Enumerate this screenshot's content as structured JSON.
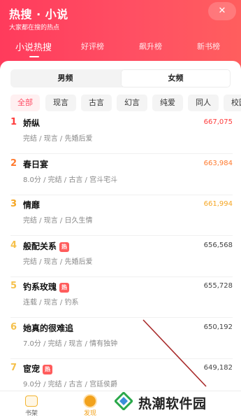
{
  "header": {
    "brand": "热搜 · 小说",
    "slogan": "大家都在搜的热点",
    "close_icon": "✕",
    "tabs": [
      {
        "label": "小说热搜",
        "active": true
      },
      {
        "label": "好评榜",
        "active": false
      },
      {
        "label": "飙升榜",
        "active": false
      },
      {
        "label": "新书榜",
        "active": false
      }
    ],
    "accent_color": "#ff4b63"
  },
  "gender_tabs": [
    {
      "label": "男频",
      "selected": false
    },
    {
      "label": "女频",
      "selected": true
    }
  ],
  "category_chips": [
    {
      "label": "全部",
      "active": true
    },
    {
      "label": "现言",
      "active": false
    },
    {
      "label": "古言",
      "active": false
    },
    {
      "label": "幻言",
      "active": false
    },
    {
      "label": "纯爱",
      "active": false
    },
    {
      "label": "同人",
      "active": false
    },
    {
      "label": "校园",
      "active": false
    }
  ],
  "ranking": [
    {
      "rank": "1",
      "title": "娇纵",
      "hot": false,
      "meta": "完结 / 现言 / 先婚后爱",
      "count": "667,075",
      "rank_color": "#ff3b3b",
      "count_color": "#ff3b3b"
    },
    {
      "rank": "2",
      "title": "春日宴",
      "hot": false,
      "meta": "8.0分 / 完结 / 古言 / 宫斗宅斗",
      "count": "663,984",
      "rank_color": "#ff7a2e",
      "count_color": "#ff7a2e"
    },
    {
      "rank": "3",
      "title": "情靡",
      "hot": false,
      "meta": "完结 / 现言 / 日久生情",
      "count": "661,994",
      "rank_color": "#f5a623",
      "count_color": "#f5a623"
    },
    {
      "rank": "4",
      "title": "般配关系",
      "hot": true,
      "meta": "完结 / 现言 / 先婚后爱",
      "count": "656,568",
      "rank_color": "#f5c04a",
      "count_color": "#444444"
    },
    {
      "rank": "5",
      "title": "钓系玫瑰",
      "hot": true,
      "meta": "连载 / 现言 / 钓系",
      "count": "655,728",
      "rank_color": "#f5c04a",
      "count_color": "#444444"
    },
    {
      "rank": "6",
      "title": "她真的很难追",
      "hot": false,
      "meta": "7.0分 / 完结 / 现言 / 情有独钟",
      "count": "650,192",
      "rank_color": "#f5c04a",
      "count_color": "#444444"
    },
    {
      "rank": "7",
      "title": "宦宠",
      "hot": true,
      "meta": "9.0分 / 完结 / 古言 / 宫廷侯爵",
      "count": "649,182",
      "rank_color": "#f5c04a",
      "count_color": "#444444"
    }
  ],
  "hot_badge": "热",
  "bottom_nav": [
    {
      "label": "书架",
      "icon": "bookshelf-icon",
      "active": false
    },
    {
      "label": "发现",
      "icon": "discover-icon",
      "active": true
    }
  ],
  "watermark": {
    "text": "热潮软件园",
    "icon": "diamond-logo-icon"
  }
}
